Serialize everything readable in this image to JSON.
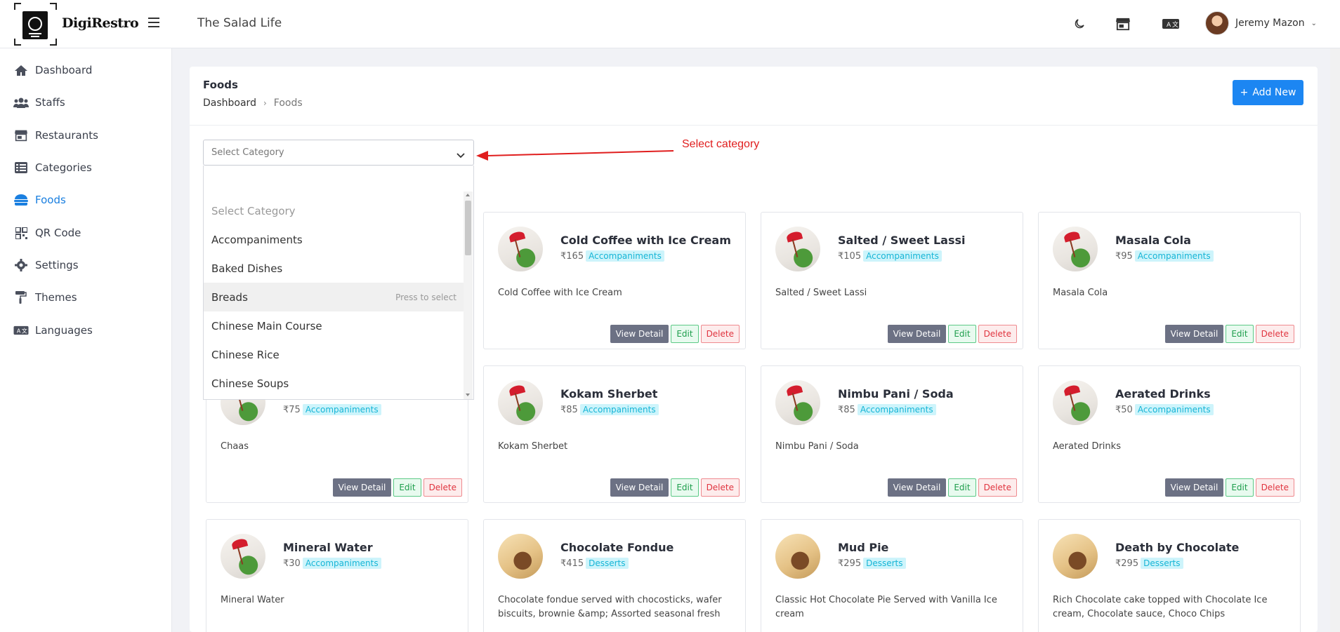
{
  "header": {
    "brand": "DigiRestro",
    "restaurant": "The Salad Life",
    "user_name": "Jeremy Mazon",
    "icons": [
      "moon-icon",
      "store-icon",
      "language-icon"
    ]
  },
  "sidebar": {
    "items": [
      {
        "label": "Dashboard",
        "icon": "home-icon"
      },
      {
        "label": "Staffs",
        "icon": "users-icon"
      },
      {
        "label": "Restaurants",
        "icon": "store-icon"
      },
      {
        "label": "Categories",
        "icon": "list-icon"
      },
      {
        "label": "Foods",
        "icon": "hamburger-food-icon",
        "active": true
      },
      {
        "label": "QR Code",
        "icon": "qr-code-icon"
      },
      {
        "label": "Settings",
        "icon": "gear-icon"
      },
      {
        "label": "Themes",
        "icon": "paint-roller-icon"
      },
      {
        "label": "Languages",
        "icon": "language-icon"
      }
    ]
  },
  "page": {
    "title": "Foods",
    "breadcrumb": {
      "home": "Dashboard",
      "current": "Foods"
    },
    "add_button": "Add New"
  },
  "select": {
    "placeholder": "Select Category",
    "options": [
      {
        "label": "Select Category",
        "placeholder": true
      },
      {
        "label": "Accompaniments"
      },
      {
        "label": "Baked Dishes"
      },
      {
        "label": "Breads",
        "hover": true,
        "hint": "Press to select"
      },
      {
        "label": "Chinese Main Course"
      },
      {
        "label": "Chinese Rice"
      },
      {
        "label": "Chinese Soups"
      }
    ]
  },
  "annotation": "Select  category",
  "foods": [
    {
      "name": "Cold Coffee with Ice Cream",
      "price": "₹165",
      "category": "Accompaniments",
      "description": "Cold Coffee with Ice Cream",
      "image": "drink"
    },
    {
      "name": "Salted / Sweet Lassi",
      "price": "₹105",
      "category": "Accompaniments",
      "description": "Salted / Sweet Lassi",
      "image": "drink"
    },
    {
      "name": "Masala Cola",
      "price": "₹95",
      "category": "Accompaniments",
      "description": "Masala Cola",
      "image": "drink"
    },
    {
      "name": "",
      "price": "₹75",
      "category": "Accompaniments",
      "description": "Chaas",
      "image": "drink"
    },
    {
      "name": "Kokam Sherbet",
      "price": "₹85",
      "category": "Accompaniments",
      "description": "Kokam Sherbet",
      "image": "drink"
    },
    {
      "name": "Nimbu Pani / Soda",
      "price": "₹85",
      "category": "Accompaniments",
      "description": "Nimbu Pani / Soda",
      "image": "drink"
    },
    {
      "name": "Aerated Drinks",
      "price": "₹50",
      "category": "Accompaniments",
      "description": "Aerated Drinks",
      "image": "drink"
    },
    {
      "name": "Mineral Water",
      "price": "₹30",
      "category": "Accompaniments",
      "description": "Mineral Water",
      "image": "drink"
    },
    {
      "name": "Chocolate Fondue",
      "price": "₹415",
      "category": "Desserts",
      "description": "Chocolate fondue served with chocosticks, wafer biscuits, brownie &amp; Assorted seasonal fresh",
      "image": "dessert"
    },
    {
      "name": "Mud Pie",
      "price": "₹295",
      "category": "Desserts",
      "description": "Classic Hot Chocolate Pie Served with Vanilla Ice cream",
      "image": "dessert"
    },
    {
      "name": "Death by Chocolate",
      "price": "₹295",
      "category": "Desserts",
      "description": "Rich Chocolate cake topped with Chocolate Ice cream, Chocolate sauce, Choco Chips",
      "image": "dessert"
    }
  ],
  "card_actions": {
    "view": "View Detail",
    "edit": "Edit",
    "delete": "Delete"
  },
  "colors": {
    "accent": "#1c86f2",
    "badge_bg": "#cdf4fb",
    "badge_text": "#16b5d6",
    "annotation": "#e01e1e"
  }
}
